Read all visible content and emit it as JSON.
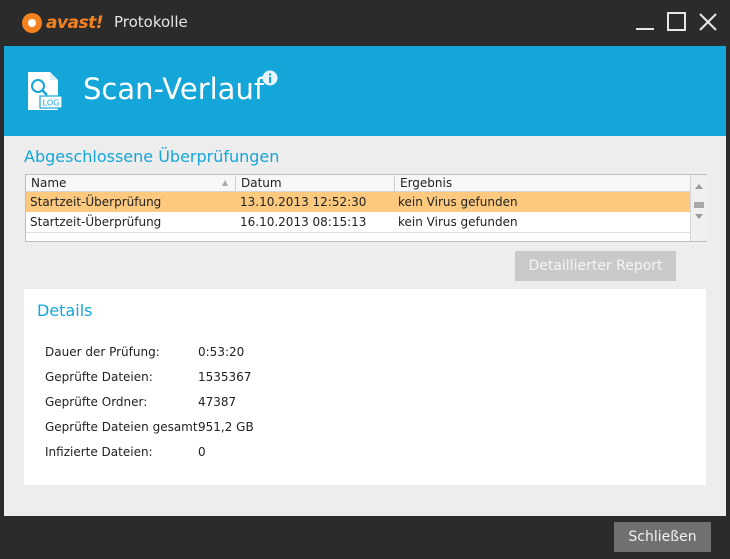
{
  "app": {
    "logo_text": "avast!",
    "window_title": "Protokolle",
    "accent_color": "#14a6d8",
    "brand_color": "#f58220"
  },
  "window_controls": {
    "minimize_icon": "minimize-icon",
    "maximize_icon": "maximize-icon",
    "close_icon": "close-icon"
  },
  "header": {
    "icon_label": "LOG",
    "title": "Scan-Verlauf",
    "info_icon": "info-icon"
  },
  "scans": {
    "section_title": "Abgeschlossene Überprüfungen",
    "columns": [
      "Name",
      "Datum",
      "Ergebnis"
    ],
    "rows": [
      {
        "name": "Startzeit-Überprüfung",
        "datum": "13.10.2013 12:52:30",
        "ergebnis": "kein Virus gefunden",
        "selected": true
      },
      {
        "name": "Startzeit-Überprüfung",
        "datum": "16.10.2013 08:15:13",
        "ergebnis": "kein Virus gefunden",
        "selected": false
      }
    ],
    "selected_row_color": "#fcc97e"
  },
  "report_button": {
    "label": "Detaillierter Report",
    "enabled": false
  },
  "details": {
    "title": "Details",
    "items": [
      {
        "label": "Dauer der Prüfung:",
        "value": "0:53:20"
      },
      {
        "label": "Geprüfte Dateien:",
        "value": "1535367"
      },
      {
        "label": "Geprüfte Ordner:",
        "value": "47387"
      },
      {
        "label": "Geprüfte Dateien gesamt:",
        "value": "951,2 GB"
      },
      {
        "label": "Infizierte Dateien:",
        "value": "0"
      }
    ]
  },
  "footer": {
    "close_label": "Schließen"
  }
}
